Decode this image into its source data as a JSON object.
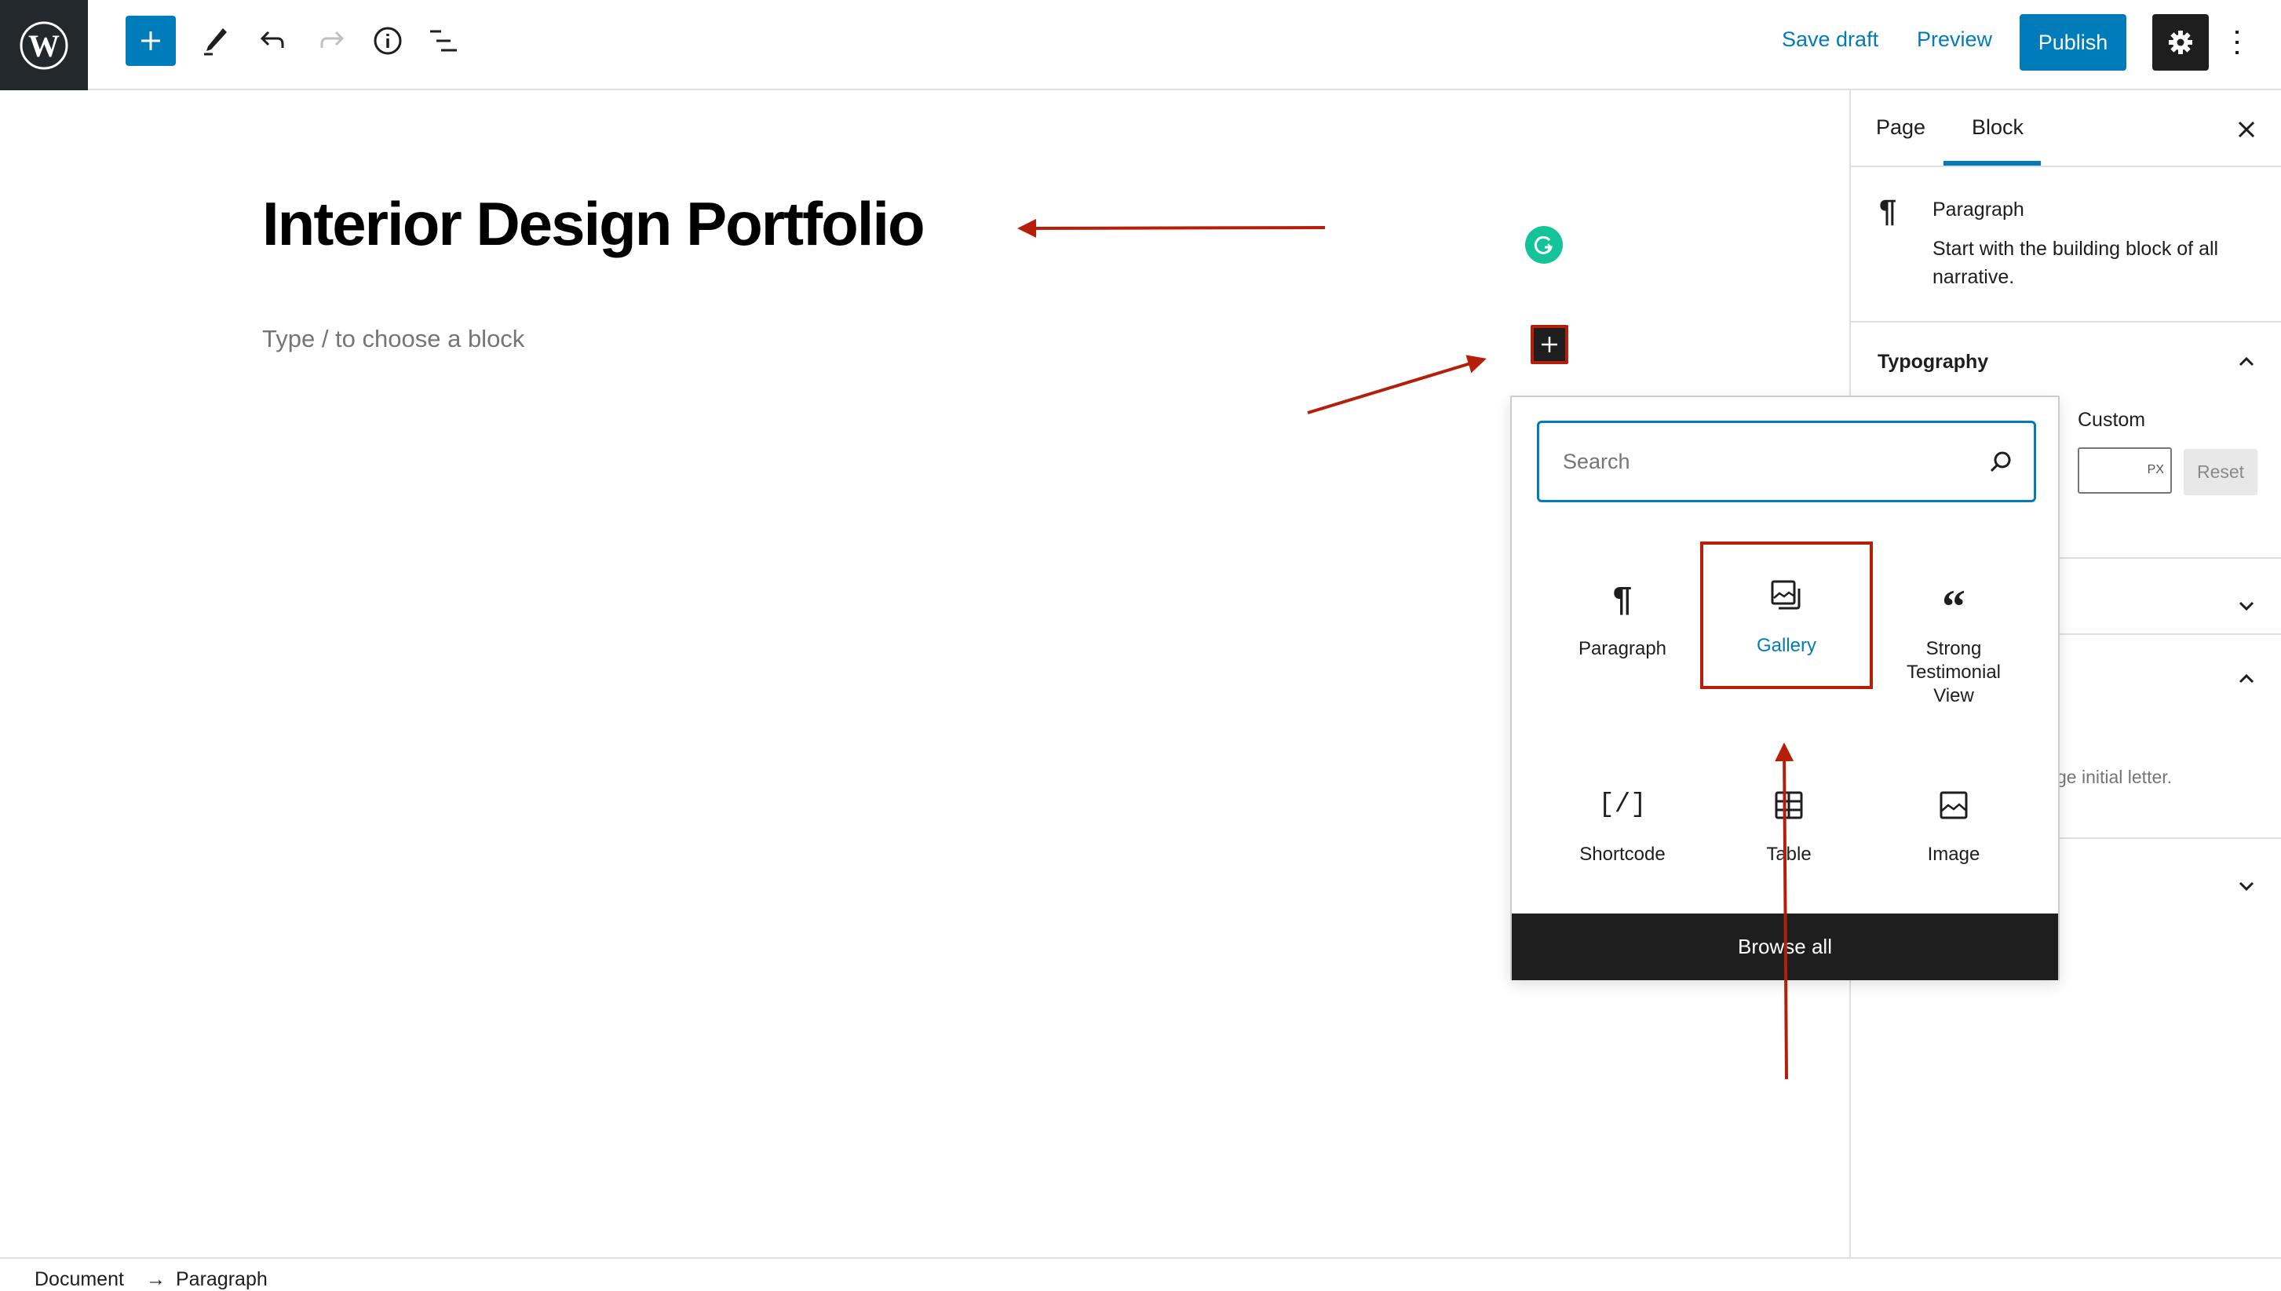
{
  "topbar": {
    "logo": "wordpress-logo",
    "tools": [
      {
        "name": "add-block",
        "icon": "plus-icon"
      },
      {
        "name": "tools",
        "icon": "pencil-icon"
      },
      {
        "name": "undo",
        "icon": "undo-icon"
      },
      {
        "name": "redo",
        "icon": "redo-icon",
        "disabled": true
      },
      {
        "name": "details",
        "icon": "info-icon"
      },
      {
        "name": "list-view",
        "icon": "list-view-icon"
      }
    ],
    "save_draft": "Save draft",
    "preview": "Preview",
    "publish": "Publish",
    "settings_icon": "gear-icon",
    "more_icon": "more-vertical-icon"
  },
  "editor": {
    "title": "Interior Design Portfolio",
    "placeholder": "Type / to choose a block"
  },
  "sidebar": {
    "tabs": [
      {
        "label": "Page",
        "active": false
      },
      {
        "label": "Block",
        "active": true
      }
    ],
    "block_card": {
      "icon": "paragraph-icon",
      "title": "Paragraph",
      "description": "Start with the building block of all narrative."
    },
    "typography": {
      "title": "Typography",
      "expanded": true,
      "custom_label": "Custom",
      "custom_value": "",
      "unit": "PX",
      "reset": "Reset"
    },
    "partial_help_text": "ge initial letter."
  },
  "inserter": {
    "search_placeholder": "Search",
    "blocks": [
      {
        "label": "Paragraph",
        "icon": "paragraph-icon",
        "highlighted": false
      },
      {
        "label": "Gallery",
        "icon": "gallery-icon",
        "highlighted": true
      },
      {
        "label": "Strong Testimonial View",
        "icon": "quote-icon",
        "highlighted": false
      },
      {
        "label": "Shortcode",
        "icon": "shortcode-icon",
        "highlighted": false
      },
      {
        "label": "Table",
        "icon": "table-icon",
        "highlighted": false
      },
      {
        "label": "Image",
        "icon": "image-icon",
        "highlighted": false
      }
    ],
    "browse_all": "Browse all"
  },
  "footer": {
    "breadcrumb": [
      "Document",
      "Paragraph"
    ]
  },
  "colors": {
    "accent": "#007cba",
    "dark": "#1e1e1e",
    "annotation": "#b51f09",
    "grammarly": "#15c39a"
  }
}
